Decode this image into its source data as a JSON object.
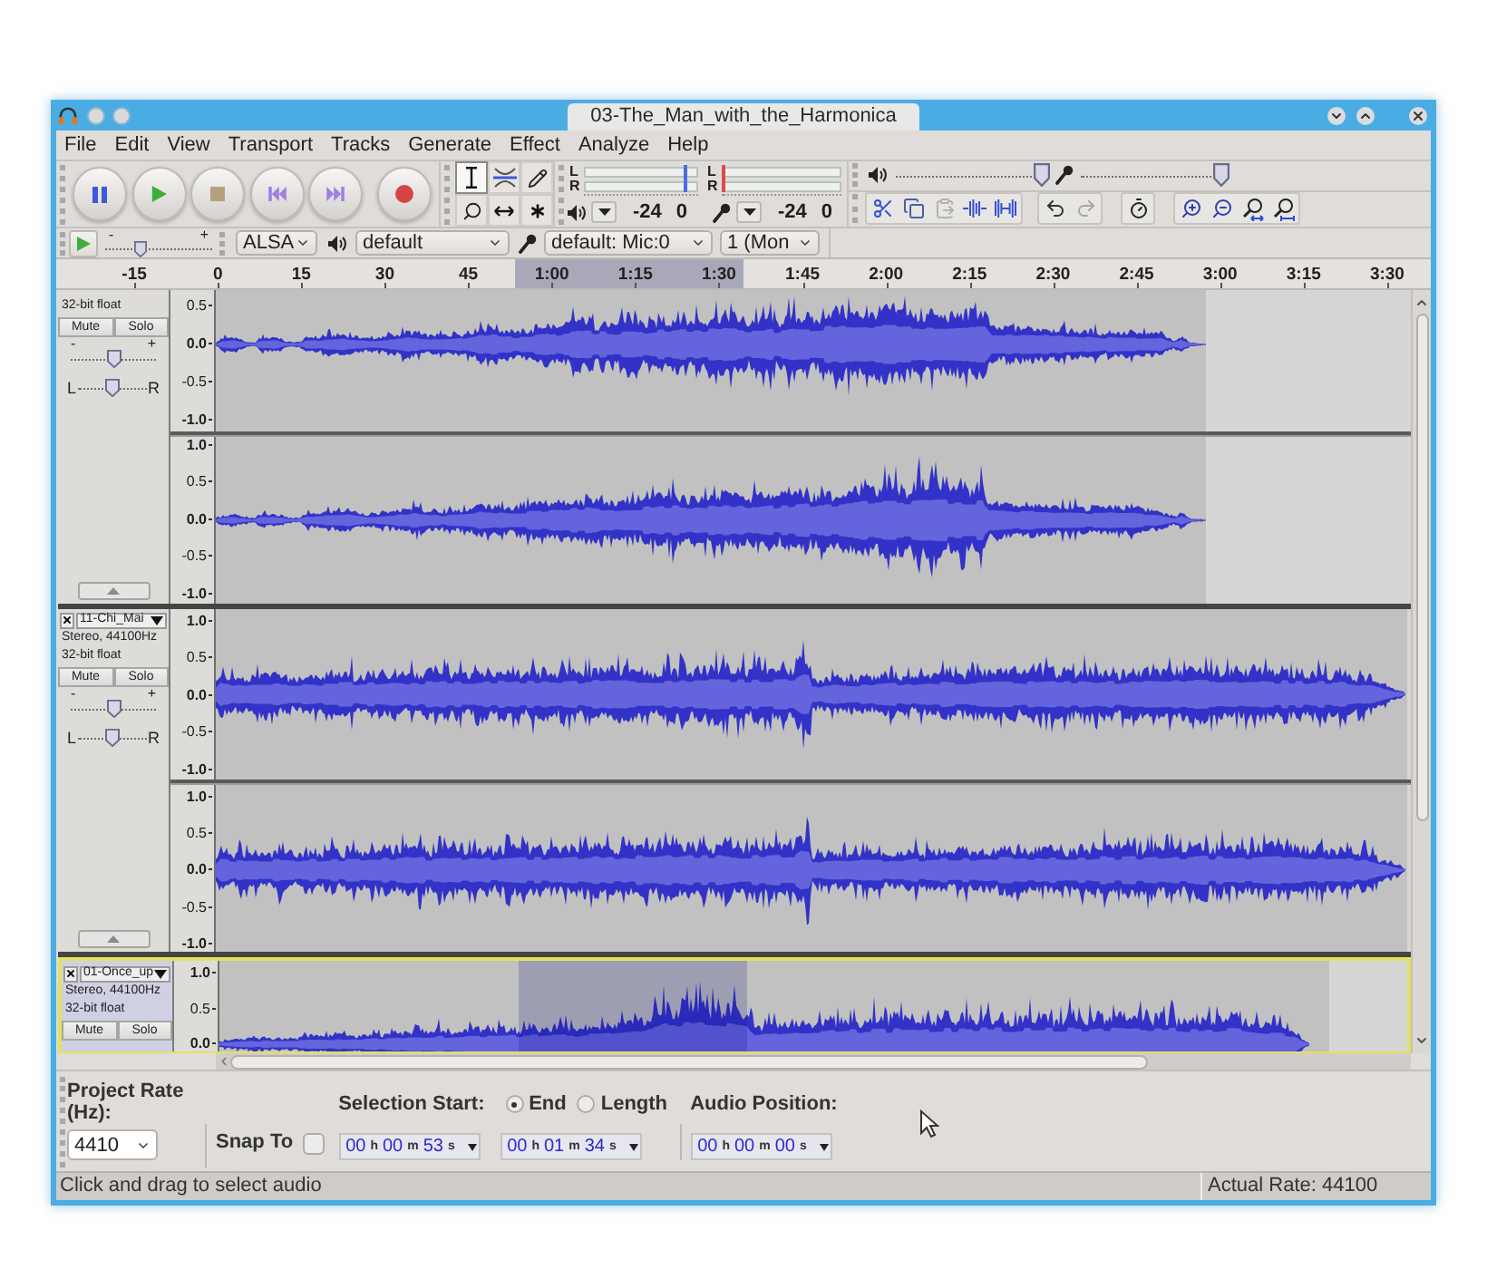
{
  "window": {
    "title": "03-The_Man_with_the_Harmonica"
  },
  "menu": [
    "File",
    "Edit",
    "View",
    "Transport",
    "Tracks",
    "Generate",
    "Effect",
    "Analyze",
    "Help"
  ],
  "transport": [
    {
      "kind": "pause"
    },
    {
      "kind": "play"
    },
    {
      "kind": "stop"
    },
    {
      "kind": "skip-start"
    },
    {
      "kind": "skip-end"
    },
    {
      "kind": "record"
    }
  ],
  "tools": [
    {
      "kind": "select",
      "selected": true
    },
    {
      "kind": "envelope",
      "selected": false
    },
    {
      "kind": "draw",
      "selected": false
    },
    {
      "kind": "zoom",
      "selected": false
    },
    {
      "kind": "time-shift",
      "selected": false
    },
    {
      "kind": "multi",
      "selected": false
    }
  ],
  "meters": [
    {
      "kind": "playback",
      "channels": [
        "L",
        "R"
      ],
      "scale": [
        "-24",
        "0"
      ]
    },
    {
      "kind": "recording",
      "channels": [
        "L",
        "R"
      ],
      "scale": [
        "-24",
        "0"
      ]
    }
  ],
  "mixer": [
    {
      "kind": "playback",
      "level": 1
    },
    {
      "kind": "recording",
      "level": 1
    }
  ],
  "edit_toolbar": [
    [
      {
        "kind": "cut",
        "disabled": false
      },
      {
        "kind": "copy",
        "disabled": false
      },
      {
        "kind": "paste",
        "disabled": true
      },
      {
        "kind": "trim",
        "disabled": false
      },
      {
        "kind": "silence",
        "disabled": false
      }
    ],
    [
      {
        "kind": "undo",
        "disabled": false
      },
      {
        "kind": "redo",
        "disabled": true
      }
    ],
    [
      {
        "kind": "sync-lock",
        "disabled": false
      }
    ],
    [
      {
        "kind": "zoom-in",
        "disabled": false
      },
      {
        "kind": "zoom-out",
        "disabled": false
      },
      {
        "kind": "fit-selection",
        "disabled": false
      },
      {
        "kind": "fit-project",
        "disabled": false
      }
    ]
  ],
  "device_toolbar": {
    "speed": {
      "min": "-",
      "max": "+",
      "level": 0.3
    },
    "host": "ALSA",
    "playback_device": "default",
    "recording_device": "default: Mic:0",
    "recording_channels": "1 (Mon"
  },
  "timeline": {
    "labels": [
      "-15",
      "0",
      "15",
      "30",
      "45",
      "1:00",
      "1:15",
      "1:30",
      "1:45",
      "2:00",
      "2:15",
      "2:30",
      "2:45",
      "3:00",
      "3:15",
      "3:30"
    ]
  },
  "tracks": [
    {
      "selected": false,
      "info": [
        "32-bit float"
      ],
      "mute": "Mute",
      "solo": "Solo",
      "gain": {
        "min": "-",
        "max": "+",
        "level": 0.5
      },
      "pan": {
        "min": "L",
        "max": "R",
        "level": 0.5
      },
      "channels": [
        {
          "ticks": [
            {
              "label": "0.5",
              "major": false
            },
            {
              "label": "0.0",
              "major": true
            },
            {
              "label": "-0.5",
              "major": false
            },
            {
              "label": "-1.0",
              "major": true
            }
          ]
        },
        {
          "ticks": [
            {
              "label": "1.0",
              "major": true
            },
            {
              "label": "0.5",
              "major": false
            },
            {
              "label": "0.0",
              "major": true
            },
            {
              "label": "-0.5",
              "major": false
            },
            {
              "label": "-1.0",
              "major": true
            }
          ]
        }
      ]
    },
    {
      "selected": false,
      "name": "11-Chi_Mai",
      "info": [
        "Stereo, 44100Hz",
        "32-bit float"
      ],
      "mute": "Mute",
      "solo": "Solo",
      "gain": {
        "min": "-",
        "max": "+",
        "level": 0.5
      },
      "pan": {
        "min": "L",
        "max": "R",
        "level": 0.5
      },
      "channels": [
        {
          "ticks": [
            {
              "label": "1.0",
              "major": true
            },
            {
              "label": "0.5",
              "major": false
            },
            {
              "label": "0.0",
              "major": true
            },
            {
              "label": "-0.5",
              "major": false
            },
            {
              "label": "-1.0",
              "major": true
            }
          ]
        },
        {
          "ticks": [
            {
              "label": "1.0",
              "major": true
            },
            {
              "label": "0.5",
              "major": false
            },
            {
              "label": "0.0",
              "major": true
            },
            {
              "label": "-0.5",
              "major": false
            },
            {
              "label": "-1.0",
              "major": true
            }
          ]
        }
      ]
    },
    {
      "selected": true,
      "name": "01-Once_up",
      "info": [
        "Stereo, 44100Hz",
        "32-bit float"
      ],
      "mute": "Mute",
      "solo": "Solo",
      "channels": [
        {
          "ticks": [
            {
              "label": "1.0",
              "major": true
            },
            {
              "label": "0.5",
              "major": false
            },
            {
              "label": "0.0",
              "major": true
            }
          ]
        }
      ]
    }
  ],
  "selection_toolbar": {
    "rate_label": "Project Rate (Hz):",
    "rate": "4410",
    "snap_label": "Snap To",
    "snap_checked": false,
    "start_label": "Selection Start:",
    "modes": [
      {
        "label": "End",
        "selected": true
      },
      {
        "label": "Length",
        "selected": false
      }
    ],
    "position_label": "Audio Position:",
    "start": [
      {
        "value": "00",
        "unit": "h"
      },
      {
        "value": "00",
        "unit": "m"
      },
      {
        "value": "53",
        "unit": "s"
      }
    ],
    "end": [
      {
        "value": "00",
        "unit": "h"
      },
      {
        "value": "01",
        "unit": "m"
      },
      {
        "value": "34",
        "unit": "s"
      }
    ],
    "position": [
      {
        "value": "00",
        "unit": "h"
      },
      {
        "value": "00",
        "unit": "m"
      },
      {
        "value": "00",
        "unit": "s"
      }
    ]
  },
  "status_bar": {
    "message": "Click and drag to select audio",
    "actual_rate": "Actual Rate: 44100"
  }
}
